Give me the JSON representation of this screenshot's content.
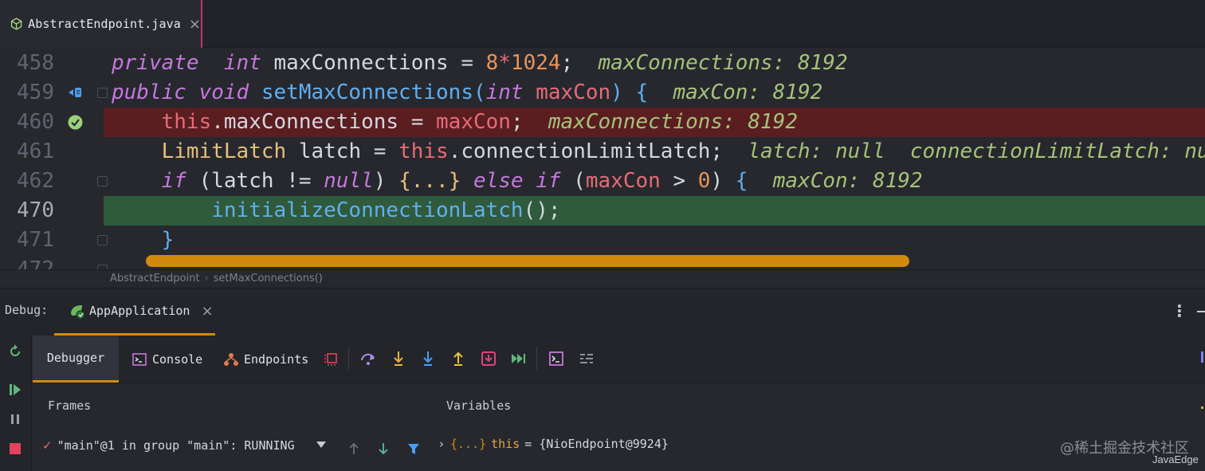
{
  "editor": {
    "tab": {
      "label": "AbstractEndpoint.java",
      "close": "×"
    },
    "lines": [
      {
        "num": "458",
        "tokens": [
          [
            "kw",
            "private"
          ],
          [
            "",
            "  "
          ],
          [
            "kw",
            "int"
          ],
          [
            "",
            " maxConnections = "
          ],
          [
            "num-lit",
            "8"
          ],
          [
            "var",
            "*"
          ],
          [
            "num-lit",
            "1024"
          ],
          [
            "",
            ";  "
          ],
          [
            "hint",
            "maxConnections: 8192"
          ]
        ]
      },
      {
        "num": "459",
        "tokens": [
          [
            "kw",
            "public"
          ],
          [
            "",
            " "
          ],
          [
            "kw",
            "void"
          ],
          [
            "",
            " "
          ],
          [
            "fn",
            "setMaxConnections"
          ],
          [
            "fn",
            "("
          ],
          [
            "kw",
            "int"
          ],
          [
            "",
            " "
          ],
          [
            "var",
            "maxCon"
          ],
          [
            "fn",
            ")"
          ],
          [
            "",
            " "
          ],
          [
            "fn",
            "{"
          ],
          [
            "",
            "  "
          ],
          [
            "hint",
            "maxCon: 8192"
          ]
        ]
      },
      {
        "num": "460",
        "tokens": [
          [
            "",
            "    "
          ],
          [
            "var",
            "this"
          ],
          [
            "",
            ".maxConnections = "
          ],
          [
            "var",
            "maxCon"
          ],
          [
            "",
            ";  "
          ],
          [
            "hint",
            "maxConnections: 8192"
          ]
        ]
      },
      {
        "num": "461",
        "tokens": [
          [
            "",
            "    "
          ],
          [
            "braces-y",
            "LimitLatch"
          ],
          [
            "",
            " latch = "
          ],
          [
            "var",
            "this"
          ],
          [
            "",
            ".connectionLimitLatch;  "
          ],
          [
            "hint",
            "latch: null  connectionLimitLatch: null"
          ]
        ]
      },
      {
        "num": "462",
        "tokens": [
          [
            "",
            "    "
          ],
          [
            "kw",
            "if"
          ],
          [
            "",
            " ("
          ],
          [
            "",
            "latch != "
          ],
          [
            "kw",
            "null"
          ],
          [
            "",
            ") "
          ],
          [
            "braces-y",
            "{...}"
          ],
          [
            "",
            " "
          ],
          [
            "kw",
            "else if"
          ],
          [
            "",
            " ("
          ],
          [
            "var",
            "maxCon"
          ],
          [
            "",
            " > "
          ],
          [
            "num-lit",
            "0"
          ],
          [
            "",
            ") "
          ],
          [
            "fn",
            "{"
          ],
          [
            "",
            "  "
          ],
          [
            "hint",
            "maxCon: 8192"
          ]
        ]
      },
      {
        "num": "470",
        "tokens": [
          [
            "",
            "        "
          ],
          [
            "fn",
            "initializeConnectionLatch"
          ],
          [
            "",
            "();"
          ]
        ]
      },
      {
        "num": "471",
        "tokens": [
          [
            "",
            "    "
          ],
          [
            "fn",
            "}"
          ]
        ]
      },
      {
        "num": "472",
        "tokens": []
      }
    ],
    "breadcrumb": [
      "AbstractEndpoint",
      "setMaxConnections()"
    ]
  },
  "debug": {
    "title": "Debug:",
    "run_tab": "AppApplication",
    "run_tab_close": "×",
    "tabs": {
      "debugger": "Debugger",
      "console": "Console",
      "endpoints": "Endpoints"
    },
    "frames_title": "Frames",
    "variables_title": "Variables",
    "frame": "\"main\"@1 in group \"main\": RUNNING",
    "frame_check": "✓",
    "variable": {
      "icon": "{...}",
      "name": "this",
      "value": "= {NioEndpoint@9924}"
    }
  },
  "watermark": "@稀土掘金技术社区",
  "watermark_sub": "JavaEdge",
  "colors": {
    "accent": "#d08a0c",
    "breakpoint_line": "#5a1d20",
    "execution_line": "#2f5a3c",
    "tab_marker": "#c7345e"
  }
}
